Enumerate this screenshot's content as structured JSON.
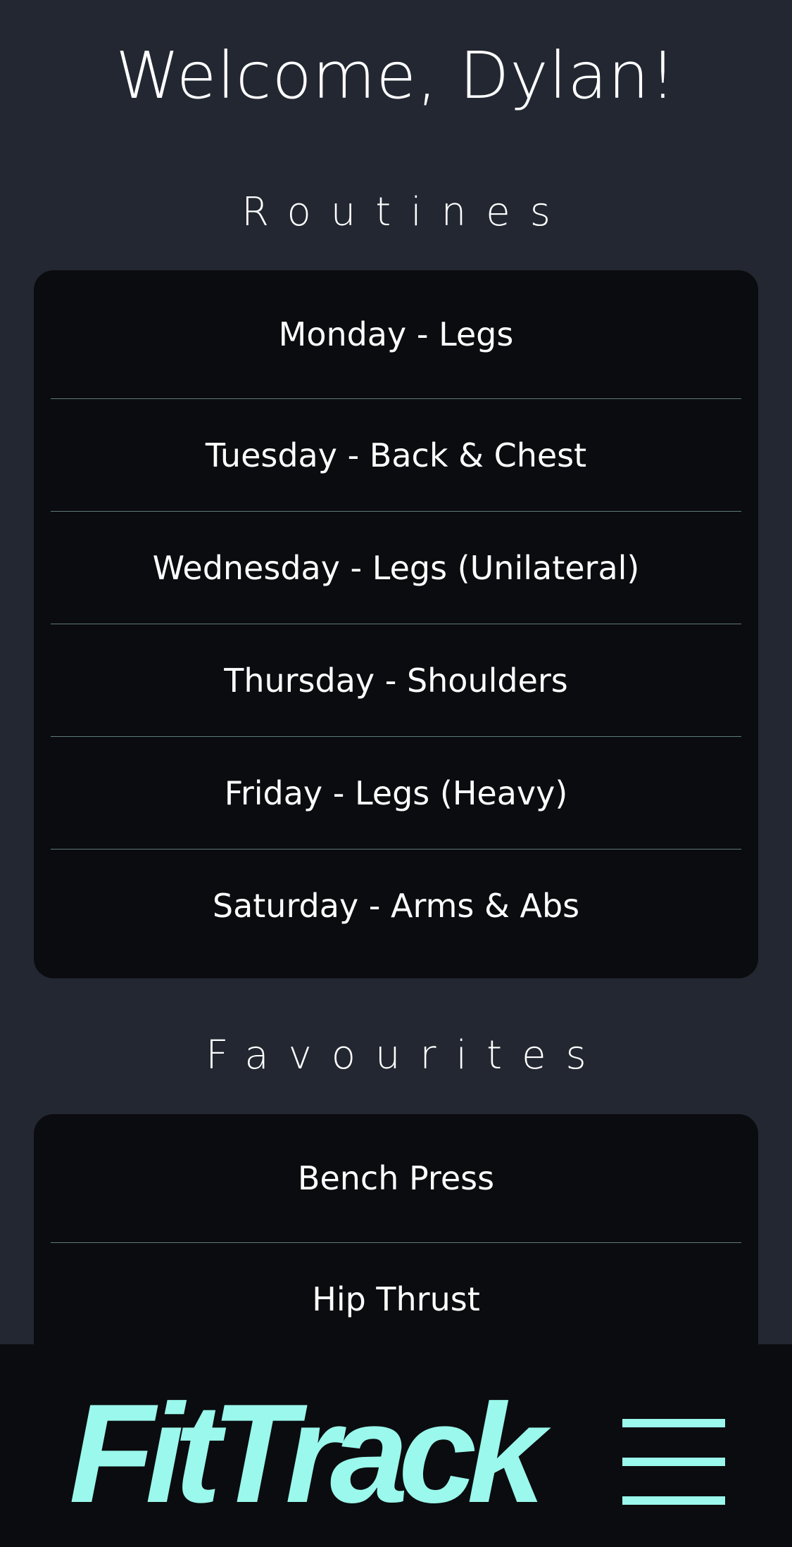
{
  "header": {
    "welcome": "Welcome, Dylan!"
  },
  "routines": {
    "title": "Routines",
    "items": [
      {
        "label": "Monday - Legs"
      },
      {
        "label": "Tuesday - Back & Chest"
      },
      {
        "label": "Wednesday - Legs (Unilateral)"
      },
      {
        "label": "Thursday - Shoulders"
      },
      {
        "label": "Friday - Legs (Heavy)"
      },
      {
        "label": "Saturday - Arms & Abs"
      }
    ]
  },
  "favourites": {
    "title": "Favourites",
    "items": [
      {
        "label": "Bench Press"
      },
      {
        "label": "Hip Thrust"
      }
    ]
  },
  "footer": {
    "logo": "FitTrack",
    "menu_icon": "hamburger-menu-icon",
    "accent_color": "#9af8ec"
  },
  "colors": {
    "background": "#222731",
    "card": "#0b0c0f",
    "divider": "#5f7a7b",
    "text": "#ffffff"
  }
}
